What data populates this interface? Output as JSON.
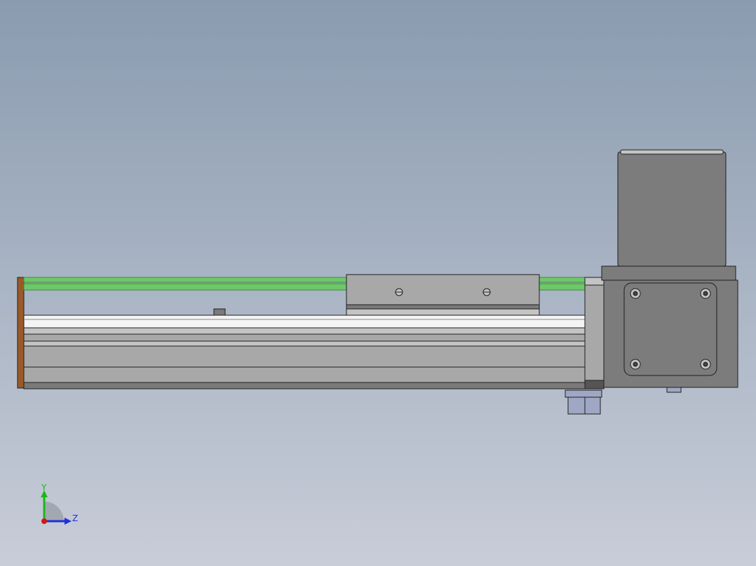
{
  "viewport": {
    "background_top": "#8a9bb0",
    "background_bottom": "#c8cdd8"
  },
  "colors": {
    "green_belt": "#6ec86a",
    "green_belt_dark": "#3d8a3a",
    "aluminum": "#a8a8a8",
    "aluminum_dark": "#7a7a7a",
    "aluminum_light": "#c4c4c4",
    "rail_white": "#f4f4f4",
    "end_cap": "#9a5a28",
    "motor": "#7c7c7c",
    "motor_dark": "#555555",
    "bracket_blue": "#9ea8c4",
    "outline": "#1e1e1e",
    "axis_y": "#18b818",
    "axis_z": "#2030d8",
    "axis_x": "#d01818"
  },
  "triad": {
    "y_label": "Y",
    "z_label": "Z"
  }
}
